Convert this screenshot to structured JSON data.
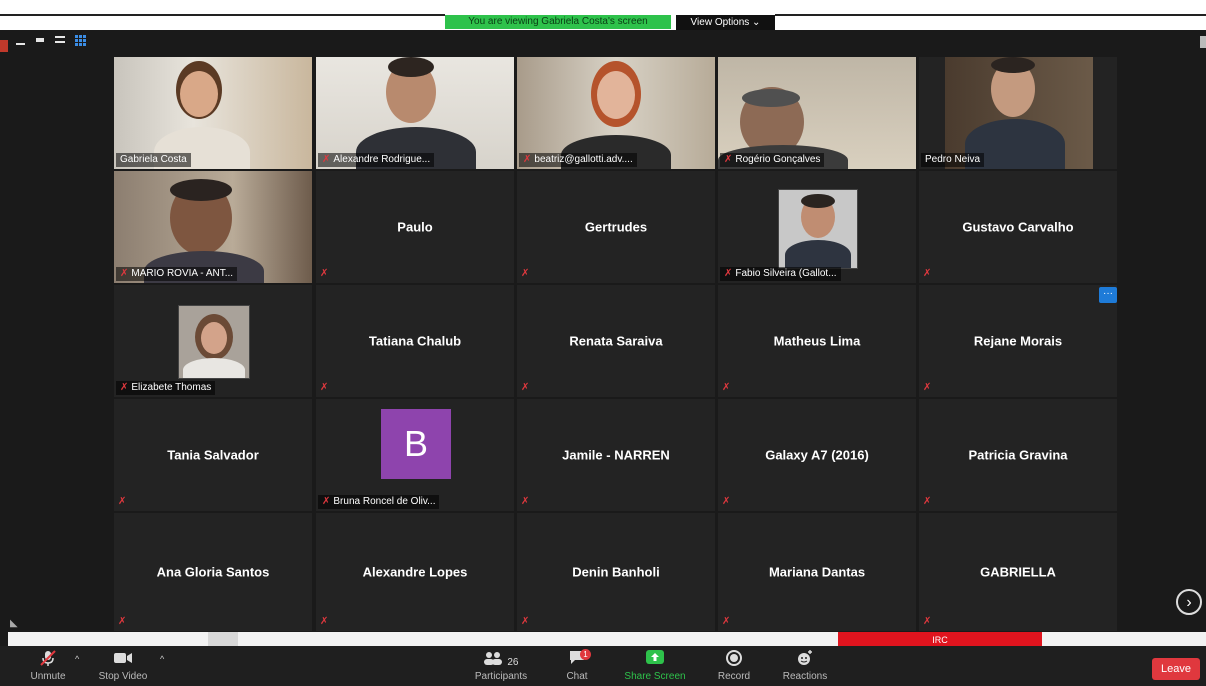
{
  "top_bar": {
    "viewing_banner": "You are viewing Gabriela Costa's screen",
    "view_options": "View Options ⌄"
  },
  "gallery": {
    "row1": [
      {
        "label": "Gabriela Costa",
        "type": "video",
        "speaking": true
      },
      {
        "label": "Alexandre Rodrigue...",
        "type": "video",
        "muted": true
      },
      {
        "label": "beatriz@gallotti.adv....",
        "type": "video",
        "muted": true
      },
      {
        "label": "Rogério Gonçalves",
        "type": "video",
        "muted": true
      },
      {
        "label": "Pedro Neiva",
        "type": "video"
      }
    ],
    "row2": [
      {
        "label": "MARIO ROVIA - ANT...",
        "type": "video",
        "muted": true
      },
      {
        "name": "Paulo",
        "type": "name"
      },
      {
        "name": "Gertrudes",
        "type": "name"
      },
      {
        "label": "Fabio Silveira (Gallot...",
        "type": "photo",
        "muted": true
      },
      {
        "name": "Gustavo Carvalho",
        "type": "name"
      }
    ],
    "row3": [
      {
        "label": "Elizabete Thomas",
        "type": "photo",
        "muted": true
      },
      {
        "name": "Tatiana Chalub",
        "type": "name"
      },
      {
        "name": "Renata Saraiva",
        "type": "name"
      },
      {
        "name": "Matheus Lima",
        "type": "name"
      },
      {
        "name": "Rejane Morais",
        "type": "name",
        "more": "···"
      }
    ],
    "row4": [
      {
        "name": "Tania Salvador",
        "type": "name"
      },
      {
        "label": "Bruna Roncel de Oliv...",
        "type": "avatar",
        "avatar_letter": "B",
        "avatar_color": "#8e44ad",
        "muted": true
      },
      {
        "name": "Jamile - NARREN",
        "type": "name"
      },
      {
        "name": "Galaxy A7 (2016)",
        "type": "name"
      },
      {
        "name": "Patricia Gravina",
        "type": "name"
      }
    ],
    "row5": [
      {
        "name": "Ana Gloria Santos",
        "type": "name"
      },
      {
        "name": "Alexandre Lopes",
        "type": "name"
      },
      {
        "name": "Denin Banholi",
        "type": "name"
      },
      {
        "name": "Mariana Dantas",
        "type": "name"
      },
      {
        "name": "GABRIELLA",
        "type": "name"
      }
    ],
    "next_page_icon": "›"
  },
  "strip": {
    "red_text": "IRC"
  },
  "toolbar": {
    "unmute": "Unmute",
    "stop_video": "Stop Video",
    "participants": "Participants",
    "participants_count": "26",
    "chat": "Chat",
    "chat_badge": "1",
    "share_screen": "Share Screen",
    "record": "Record",
    "reactions": "Reactions",
    "leave": "Leave"
  },
  "colors": {
    "accent_green": "#2ec24b",
    "leave_red": "#e0383e",
    "speaking_border": "#9ee35a",
    "mute_red": "#e0383e"
  }
}
